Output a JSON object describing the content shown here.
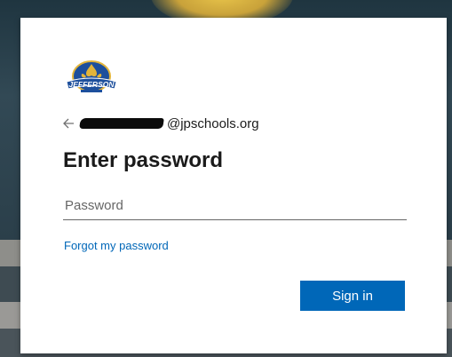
{
  "identity": {
    "email_visible_suffix": "@jpschools.org"
  },
  "login": {
    "title": "Enter password",
    "password_placeholder": "Password",
    "forgot_link": "Forgot my password",
    "signin_label": "Sign in"
  },
  "brand": {
    "logo_text": "JEFFERSON",
    "accent_color": "#0067b8",
    "logo_blue": "#1d4f9c",
    "logo_gold": "#e2b43a"
  }
}
